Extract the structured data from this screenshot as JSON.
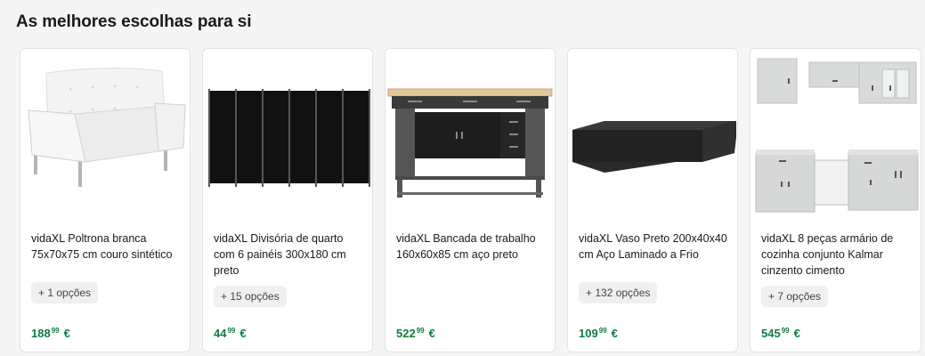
{
  "section": {
    "title": "As melhores escolhas para si"
  },
  "products": [
    {
      "title": "vidaXL Poltrona branca 75x70x75 cm couro sintético",
      "options": "+ 1 opções",
      "price_int": "188",
      "price_cents": "99",
      "currency": "€",
      "image": "white-armchair-image"
    },
    {
      "title": "vidaXL Divisória de quarto com 6 painéis 300x180 cm preto",
      "options": "+ 15 opções",
      "price_int": "44",
      "price_cents": "99",
      "currency": "€",
      "image": "room-divider-image"
    },
    {
      "title": "vidaXL Bancada de trabalho 160x60x85 cm aço preto",
      "options": "",
      "price_int": "522",
      "price_cents": "99",
      "currency": "€",
      "image": "workbench-image"
    },
    {
      "title": "vidaXL Vaso Preto 200x40x40 cm Aço Laminado a Frio",
      "options": "+ 132 opções",
      "price_int": "109",
      "price_cents": "99",
      "currency": "€",
      "image": "black-planter-image"
    },
    {
      "title": "vidaXL 8 peças armário de cozinha conjunto Kalmar cinzento cimento",
      "options": "+ 7 opções",
      "price_int": "545",
      "price_cents": "99",
      "currency": "€",
      "image": "kitchen-cabinet-set-image"
    }
  ]
}
